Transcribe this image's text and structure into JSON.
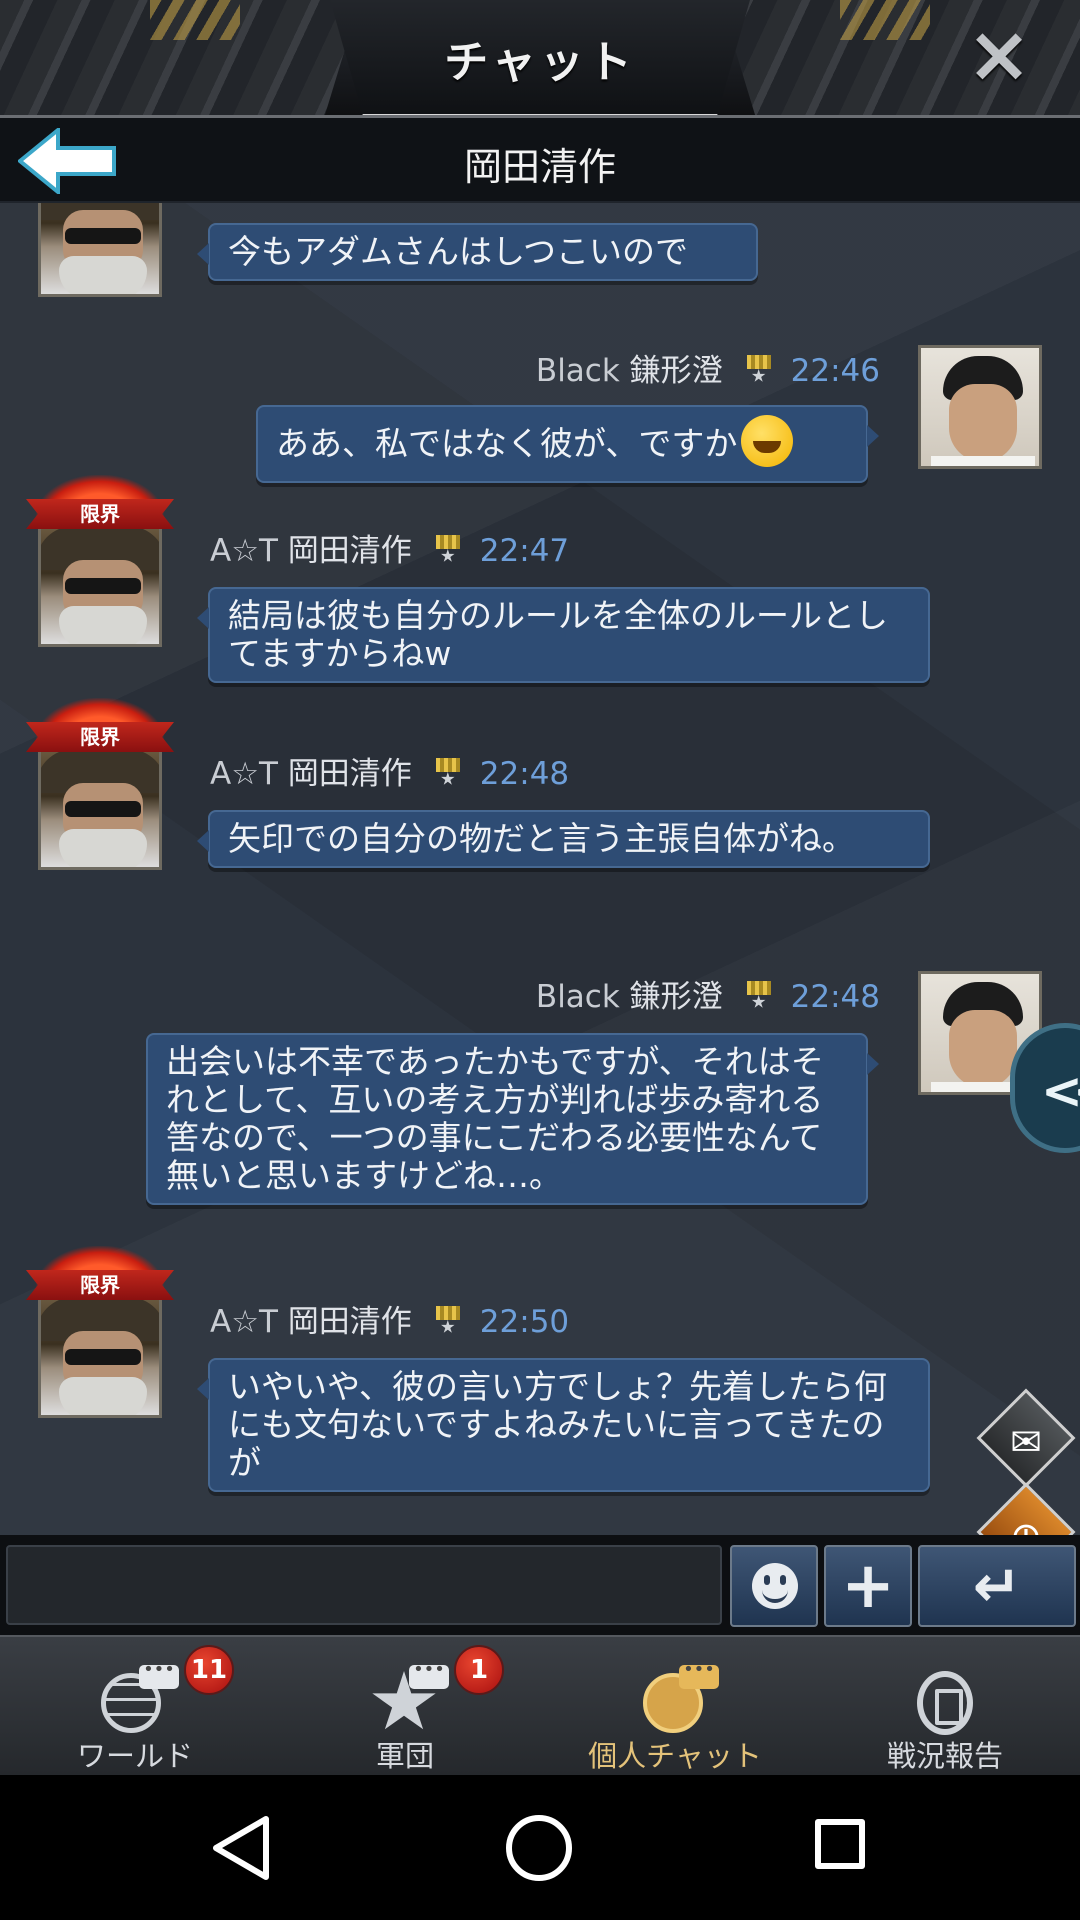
{
  "header": {
    "title": "チャット",
    "close_icon": "×",
    "sub_title": "岡田清作"
  },
  "messages": [
    {
      "side": "left",
      "text": "今もアダムさんはしつこいので"
    },
    {
      "side": "right",
      "prefix": "Black",
      "name": "鎌形澄",
      "time": "22:46",
      "text": "ああ、私ではなく彼が、ですか"
    },
    {
      "side": "left",
      "badge": "限界",
      "prefix": "A☆T",
      "name": "岡田清作",
      "time": "22:47",
      "text": "結局は彼も自分のルールを全体のルールとしてますからねw"
    },
    {
      "side": "left",
      "badge": "限界",
      "prefix": "A☆T",
      "name": "岡田清作",
      "time": "22:48",
      "text": "矢印での自分の物だと言う主張自体がね。"
    },
    {
      "side": "right",
      "prefix": "Black",
      "name": "鎌形澄",
      "time": "22:48",
      "text": "出会いは不幸であったかもですが、それはそれとして、互いの考え方が判れば歩み寄れる筈なので、一つの事にこだわる必要性なんて無いと思いますけどね…。"
    },
    {
      "side": "left",
      "badge": "限界",
      "prefix": "A☆T",
      "name": "岡田清作",
      "time": "22:50",
      "text": "いやいや、彼の言い方でしょ？先着したら何にも文句ないですよねみたいに言ってきたのが"
    }
  ],
  "side_buttons": {
    "toggle": "<<",
    "mail_icon": "envelope-icon",
    "friend_icon": "add-friend-icon"
  },
  "input": {
    "value": "",
    "placeholder": "",
    "plus": "+",
    "enter": "↵"
  },
  "tabs": [
    {
      "label": "ワールド",
      "badge": "11",
      "icon": "globe-chat-icon",
      "active": false
    },
    {
      "label": "軍団",
      "badge": "1",
      "icon": "star-chat-icon",
      "active": false
    },
    {
      "label": "個人チャット",
      "badge": null,
      "icon": "people-chat-icon",
      "active": true
    },
    {
      "label": "戦況報告",
      "badge": null,
      "icon": "report-icon",
      "active": false
    }
  ],
  "colors": {
    "bubble": "#2e4c74",
    "time": "#6e9fd9",
    "active_tab": "#e3c27a",
    "chat_bg": "#2c333d"
  }
}
